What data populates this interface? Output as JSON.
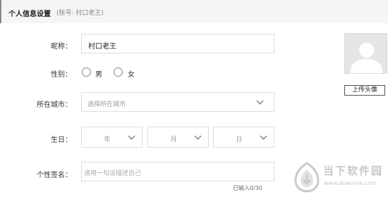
{
  "header": {
    "title": "个人信息设置",
    "account_text": "(账号: 村口老王)"
  },
  "form": {
    "nickname": {
      "label": "昵称：",
      "value": "村口老王"
    },
    "gender": {
      "label": "性别：",
      "options": [
        "男",
        "女"
      ],
      "selected": null
    },
    "city": {
      "label": "所在城市：",
      "placeholder": "选择所在城市"
    },
    "birthday": {
      "label": "生日：",
      "year": "年",
      "month": "月",
      "day": "日"
    },
    "signature": {
      "label": "个性签名：",
      "placeholder": "请用一句话描述自己",
      "counter": "已输入0/30"
    }
  },
  "avatar": {
    "icon": "default-avatar-icon",
    "upload_label": "上传头像"
  },
  "watermark": {
    "name": "当下软件园",
    "url": "www.downxia.com"
  },
  "colors": {
    "header_bg": "#f5f5f5",
    "border": "#dcdcdc",
    "placeholder": "#999999",
    "watermark": "#c7c7c7"
  }
}
